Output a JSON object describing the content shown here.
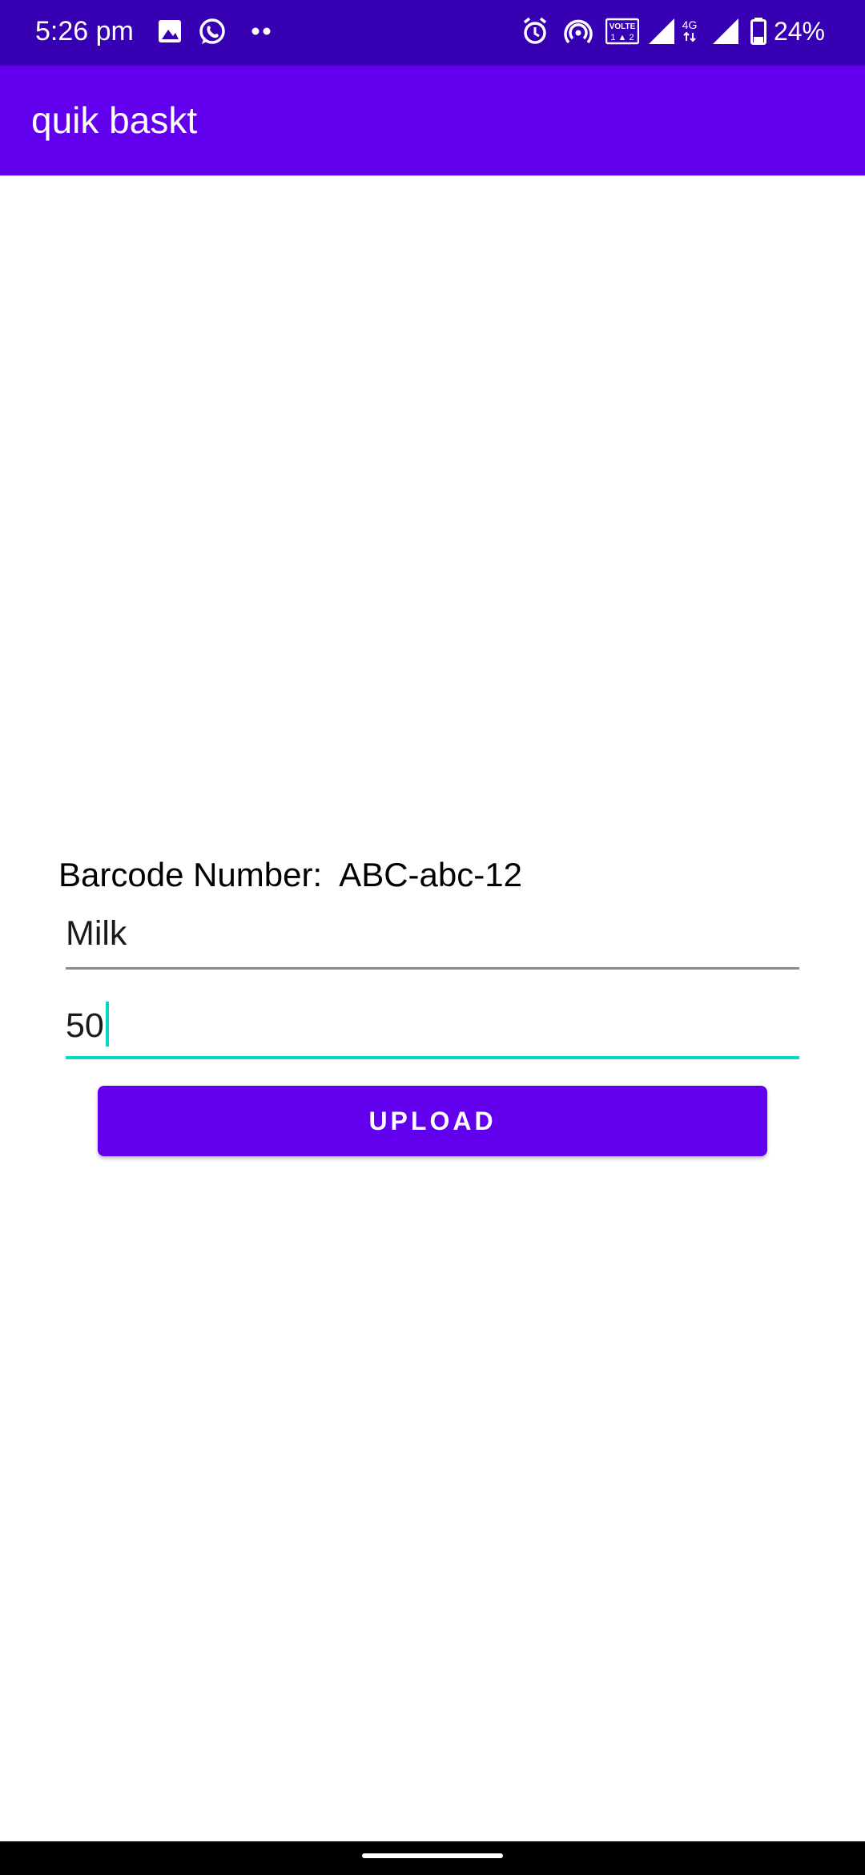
{
  "status_bar": {
    "time": "5:26 pm",
    "battery": "24%",
    "network_label": "4G",
    "volte_label": "VOLTE",
    "icons": [
      "gallery-icon",
      "whatsapp-icon",
      "more-dots-icon",
      "alarm-icon",
      "hotspot-icon",
      "volte-icon",
      "signal-icon",
      "signal-4g-icon",
      "battery-icon"
    ]
  },
  "app_bar": {
    "title": "quik baskt"
  },
  "form": {
    "barcode_label": "Barcode Number:",
    "barcode_value": "ABC-abc-12",
    "name_value": "Milk",
    "price_value": "50",
    "upload_label": "UPLOAD"
  },
  "colors": {
    "status_bar": "#3700b3",
    "primary": "#6200ee",
    "accent": "#03dac5"
  }
}
